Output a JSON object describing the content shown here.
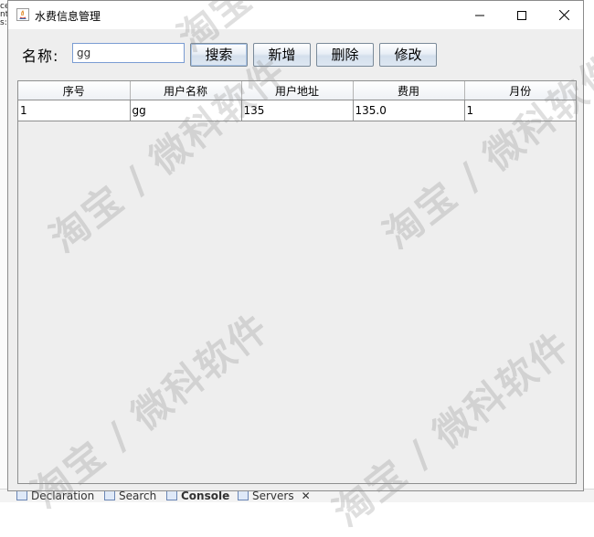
{
  "window": {
    "title": "水费信息管理",
    "controls": {
      "minimize": "minimize",
      "maximize": "maximize",
      "close": "close"
    }
  },
  "search": {
    "label": "名称:",
    "value": "gg"
  },
  "toolbar": {
    "search_label": "搜索",
    "add_label": "新增",
    "delete_label": "删除",
    "edit_label": "修改"
  },
  "table": {
    "columns": [
      "序号",
      "用户名称",
      "用户地址",
      "费用",
      "月份"
    ],
    "rows": [
      [
        "1",
        "gg",
        "135",
        "135.0",
        "1"
      ]
    ]
  },
  "ide": {
    "tabs": [
      "Declaration",
      "Search",
      "Console",
      "Servers"
    ],
    "left_fragments": [
      "ce",
      "nt",
      "s:"
    ]
  },
  "watermark": {
    "text": "淘宝 / 微科软件"
  }
}
